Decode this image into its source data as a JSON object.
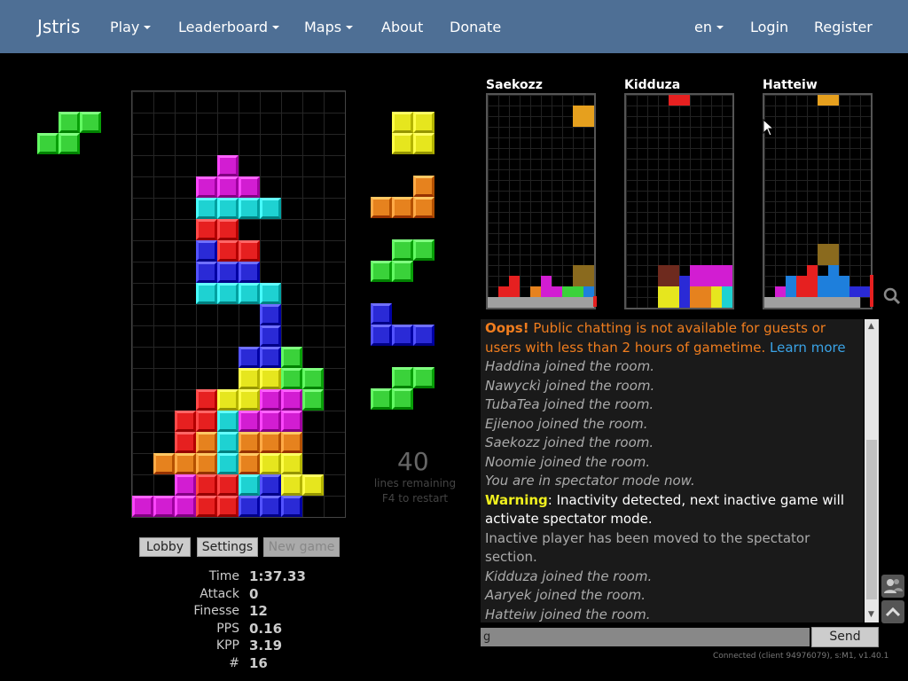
{
  "nav": {
    "brand": "Jstris",
    "play": "Play",
    "leaderboard": "Leaderboard",
    "maps": "Maps",
    "about": "About",
    "donate": "Donate",
    "lang": "en",
    "login": "Login",
    "register": "Register"
  },
  "colors": {
    "Z": "#e62020",
    "S": "#3ad23a",
    "T": "#d21dd2",
    "I": "#1ed2d2",
    "O": "#e6e61e",
    "L": "#e6821e",
    "J": "#2a2ad6",
    "G": "#a0a0a0",
    "D": "#6e2a1e",
    "Y": "#8a6a1e",
    "B": "#1e7fdc",
    "A": "#e6a01e"
  },
  "hold": {
    "piece": "S"
  },
  "board": {
    "cols": 10,
    "rows": 20,
    "grid": [
      "..........",
      "..........",
      "..........",
      "..........",
      "....T.....",
      "...TTT....",
      "...IIII...",
      "...ZZ.....",
      "...JZZ....",
      "...JJJ....",
      "...IIII...",
      "......J...",
      "......J...",
      ".....JJS..",
      ".....OOSS.",
      "...ZOOTTS.",
      "..ZZITTT..",
      "..ZLILLL..",
      ".LLLILOO..",
      "..TZZIJOO.",
      "TTTZZJJJ.."
    ]
  },
  "queue": [
    "O",
    "L",
    "S",
    "J",
    "S"
  ],
  "lines_remaining": {
    "count": "40",
    "label": "lines remaining",
    "hint": "F4 to restart"
  },
  "buttons": {
    "lobby": "Lobby",
    "settings": "Settings",
    "new_game": "New game"
  },
  "stats": [
    {
      "label": "Time",
      "value": "1:37.33"
    },
    {
      "label": "Attack",
      "value": "0"
    },
    {
      "label": "Finesse",
      "value": "12"
    },
    {
      "label": "PPS",
      "value": "0.16"
    },
    {
      "label": "KPP",
      "value": "3.19"
    },
    {
      "label": "#",
      "value": "16"
    }
  ],
  "opponents": [
    {
      "name": "Saekozz"
    },
    {
      "name": "Kidduza"
    },
    {
      "name": "Hatteiw"
    }
  ],
  "chat": {
    "oops_prefix": "Oops!",
    "oops_text": "Public chatting is not available for guests or users with less than 2 hours of gametime.",
    "learn_more": "Learn more",
    "messages1": [
      "Haddina joined the room.",
      "Nawyckì joined the room.",
      "TubaTea joined the room.",
      "Ejienoo joined the room.",
      "Saekozz joined the room.",
      "Noomie joined the room.",
      "You are in spectator mode now."
    ],
    "warning_prefix": "Warning",
    "warning_text": ": Inactivity detected, next inactive game will activate spectator mode.",
    "inactive_msg": "Inactive player has been moved to the spectator section.",
    "messages2": [
      "Kidduza joined the room.",
      "Aaryek joined the room.",
      "Hatteiw joined the room."
    ],
    "input_value": "g",
    "send_label": "Send"
  },
  "status": "Connected (client 94976079), s:M1, v1.40.1"
}
